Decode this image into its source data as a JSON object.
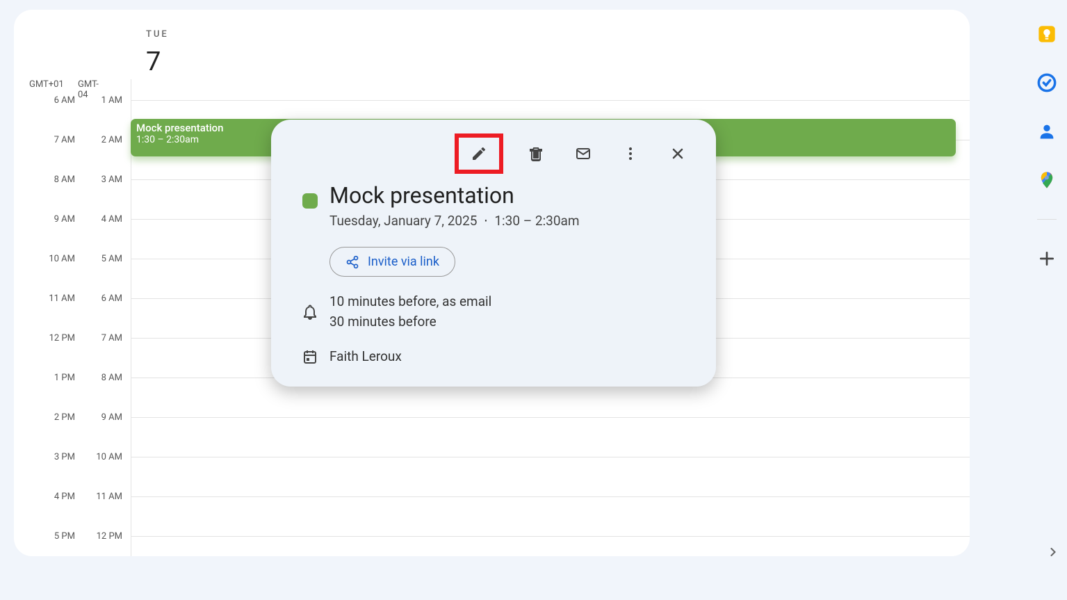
{
  "header": {
    "dayName": "TUE",
    "dayNum": "7"
  },
  "tz": {
    "left": "GMT+01",
    "right": "GMT-04"
  },
  "hours": [
    {
      "l": "6 AM",
      "r": "1 AM"
    },
    {
      "l": "7 AM",
      "r": "2 AM"
    },
    {
      "l": "8 AM",
      "r": "3 AM"
    },
    {
      "l": "9 AM",
      "r": "4 AM"
    },
    {
      "l": "10 AM",
      "r": "5 AM"
    },
    {
      "l": "11 AM",
      "r": "6 AM"
    },
    {
      "l": "12 PM",
      "r": "7 AM"
    },
    {
      "l": "1 PM",
      "r": "8 AM"
    },
    {
      "l": "2 PM",
      "r": "9 AM"
    },
    {
      "l": "3 PM",
      "r": "10 AM"
    },
    {
      "l": "4 PM",
      "r": "11 AM"
    },
    {
      "l": "5 PM",
      "r": "12 PM"
    }
  ],
  "event": {
    "title": "Mock presentation",
    "time": "1:30 – 2:30am"
  },
  "popover": {
    "title": "Mock presentation",
    "date": "Tuesday, January 7, 2025",
    "sep": "⋅",
    "time": "1:30 – 2:30am",
    "invite": "Invite via link",
    "reminder1": "10 minutes before, as email",
    "reminder2": "30 minutes before",
    "organizer": "Faith Leroux"
  }
}
